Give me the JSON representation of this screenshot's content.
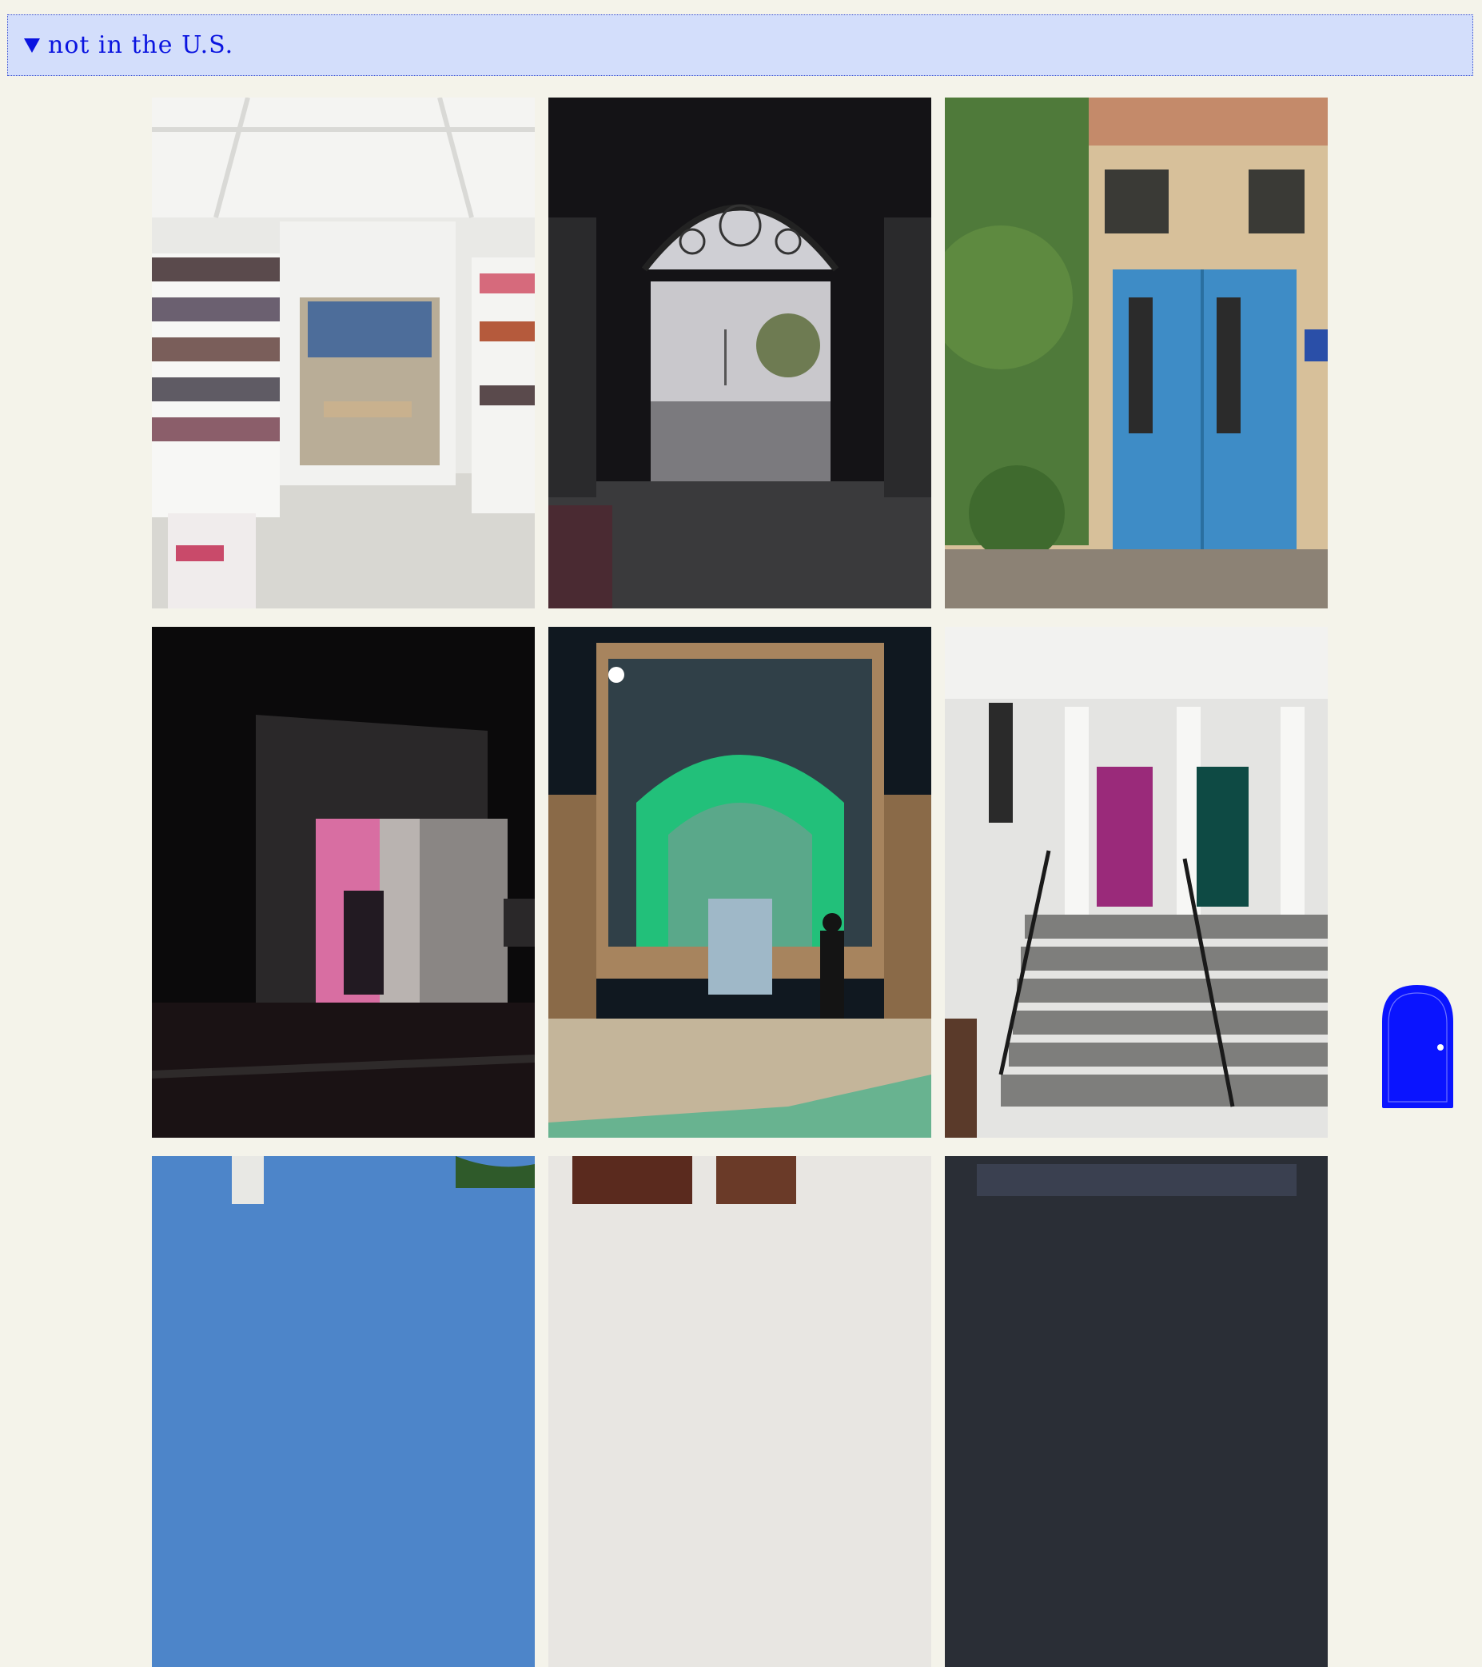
{
  "section": {
    "title": "not in the U.S.",
    "expanded": true,
    "triangle_icon": "triangle-down-icon",
    "accent_color": "#0a14e0",
    "background_color": "#d3defb"
  },
  "photos": [
    {
      "name": "photo-bookstore-interior"
    },
    {
      "name": "photo-arched-gate-courtyard"
    },
    {
      "name": "photo-blue-door"
    },
    {
      "name": "photo-pink-lit-door-night"
    },
    {
      "name": "photo-green-lit-mosque-arch"
    },
    {
      "name": "photo-townhouse-doors"
    },
    {
      "name": "photo-row3-col1"
    },
    {
      "name": "photo-row3-col2"
    },
    {
      "name": "photo-row3-col3"
    }
  ],
  "floating_button": {
    "icon": "door-icon",
    "color": "#0a14ff"
  }
}
